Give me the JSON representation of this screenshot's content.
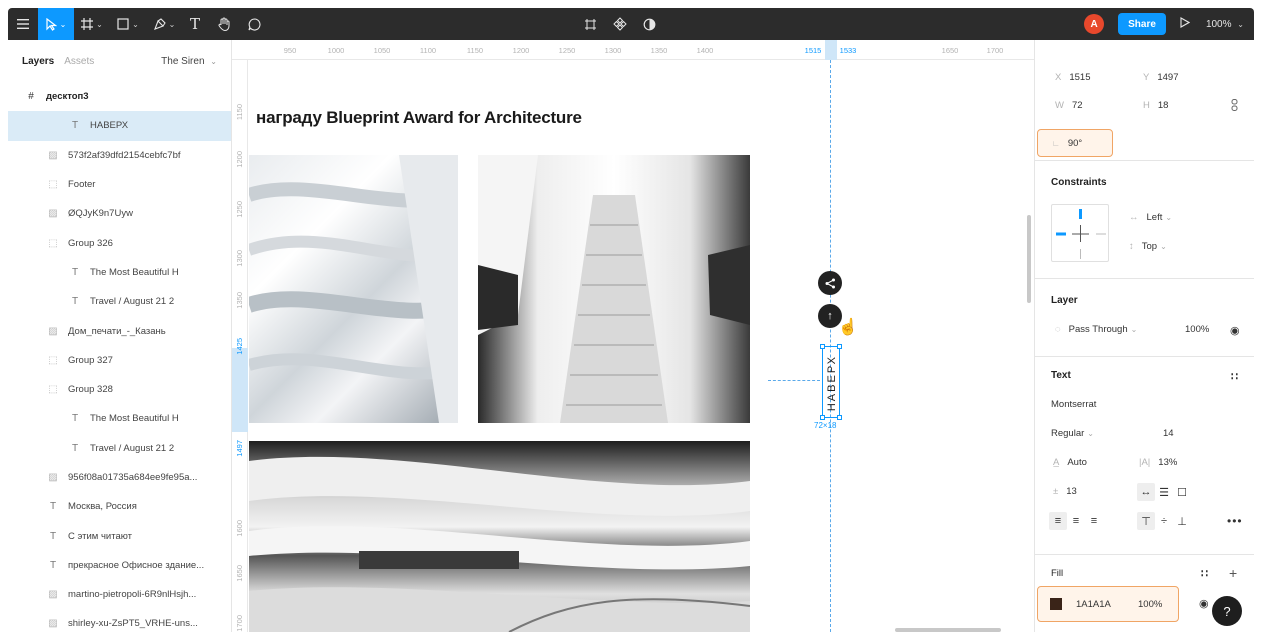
{
  "toolbar": {
    "menu_icon": "hamburger-icon",
    "tools": [
      "move",
      "frame",
      "shape",
      "pen",
      "text",
      "hand",
      "comment"
    ],
    "text_tool_glyph": "T",
    "center_tools": [
      "component",
      "assets",
      "contrast"
    ],
    "avatar_letter": "A",
    "share_label": "Share",
    "zoom": "100%",
    "active_color": "#0d99ff"
  },
  "left_panel": {
    "tab_layers": "Layers",
    "tab_assets": "Assets",
    "page_name": "The Siren",
    "layers": [
      {
        "name": "десктоп3",
        "icon": "#",
        "level": 0,
        "selected": false,
        "frame": true
      },
      {
        "name": "НАВЕРХ",
        "icon": "T",
        "level": 2,
        "selected": true
      },
      {
        "name": "573f2af39dfd2154cebfc7bf",
        "icon": "img",
        "level": 1
      },
      {
        "name": "Footer",
        "icon": "grp",
        "level": 1
      },
      {
        "name": "ØQJyK9n7Uyw",
        "icon": "img",
        "level": 1
      },
      {
        "name": "Group 326",
        "icon": "grp",
        "level": 1
      },
      {
        "name": "The Most Beautiful H",
        "icon": "T",
        "level": 2
      },
      {
        "name": "Travel / August 21 2",
        "icon": "T",
        "level": 2
      },
      {
        "name": "Дом_печати_-_Казань",
        "icon": "img",
        "level": 1
      },
      {
        "name": "Group 327",
        "icon": "grp",
        "level": 1
      },
      {
        "name": "Group 328",
        "icon": "grp",
        "level": 1
      },
      {
        "name": "The Most Beautiful H",
        "icon": "T",
        "level": 2
      },
      {
        "name": "Travel / August 21 2",
        "icon": "T",
        "level": 2
      },
      {
        "name": "956f08a01735a684ee9fe95a...",
        "icon": "img",
        "level": 1
      },
      {
        "name": "Москва, Россия",
        "icon": "T",
        "level": 1
      },
      {
        "name": "С этим читают",
        "icon": "T",
        "level": 1
      },
      {
        "name": "прекрасное Офисное здание...",
        "icon": "T",
        "level": 1
      },
      {
        "name": "martino-pietropoli-6R9nlHsjh...",
        "icon": "img",
        "level": 1
      },
      {
        "name": "shirley-xu-ZsPT5_VRHE-uns...",
        "icon": "img",
        "level": 1
      }
    ]
  },
  "canvas": {
    "ruler_top": [
      "950",
      "1000",
      "1050",
      "1100",
      "1150",
      "1200",
      "1250",
      "1300",
      "1350",
      "1400",
      "1515",
      "1533",
      "1650",
      "1700"
    ],
    "ruler_left": [
      "1150",
      "1200",
      "1250",
      "1300",
      "1350",
      "1425",
      "1497",
      "1600",
      "1650",
      "1700"
    ],
    "heading": "награду Blueprint Award for Architecture",
    "selected_text": "НАВЕРХ",
    "selection_size": "72×18",
    "share_glyph": "share-icon",
    "up_glyph": "↑"
  },
  "right_panel": {
    "x_label": "X",
    "x_value": "1515",
    "y_label": "Y",
    "y_value": "1497",
    "w_label": "W",
    "w_value": "72",
    "h_label": "H",
    "h_value": "18",
    "rotation": "90°",
    "constraints_title": "Constraints",
    "constraint_h": "Left",
    "constraint_v": "Top",
    "layer_title": "Layer",
    "blend_mode": "Pass Through",
    "layer_opacity": "100%",
    "text_title": "Text",
    "font_family": "Montserrat",
    "font_style": "Regular",
    "font_size": "14",
    "line_height": "Auto",
    "letter_spacing": "13%",
    "paragraph_spacing": "13",
    "fill_title": "Fill",
    "fill_hex": "1A1A1A",
    "fill_opacity": "100%",
    "fill_color": "#3a2418",
    "help_glyph": "?"
  }
}
